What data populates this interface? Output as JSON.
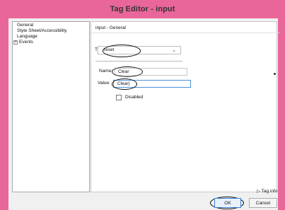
{
  "window": {
    "title": "Tag Editor - input"
  },
  "tree": {
    "items": [
      {
        "label": "General",
        "expander": ""
      },
      {
        "label": "Style Sheet/Accessibility",
        "expander": ""
      },
      {
        "label": "Language",
        "expander": ""
      },
      {
        "label": "Events",
        "expander": "+"
      }
    ],
    "selected": "General"
  },
  "panel": {
    "header": "input - General",
    "type_label": "Type:",
    "type_value": "reset",
    "type_chevron": "⌄",
    "name_label": "Name:",
    "name_value": "Clear",
    "value_label": "Value:",
    "value_value": "Clear|",
    "disabled_label": "Disabled",
    "disabled_checked": false
  },
  "footer": {
    "taginfo_label": "▷ Tag info",
    "ok_label": "OK",
    "cancel_label": "Cancel"
  },
  "colors": {
    "titlebar": "#e9669a",
    "focus_border": "#4c8fd6",
    "annotation": "#111111"
  }
}
